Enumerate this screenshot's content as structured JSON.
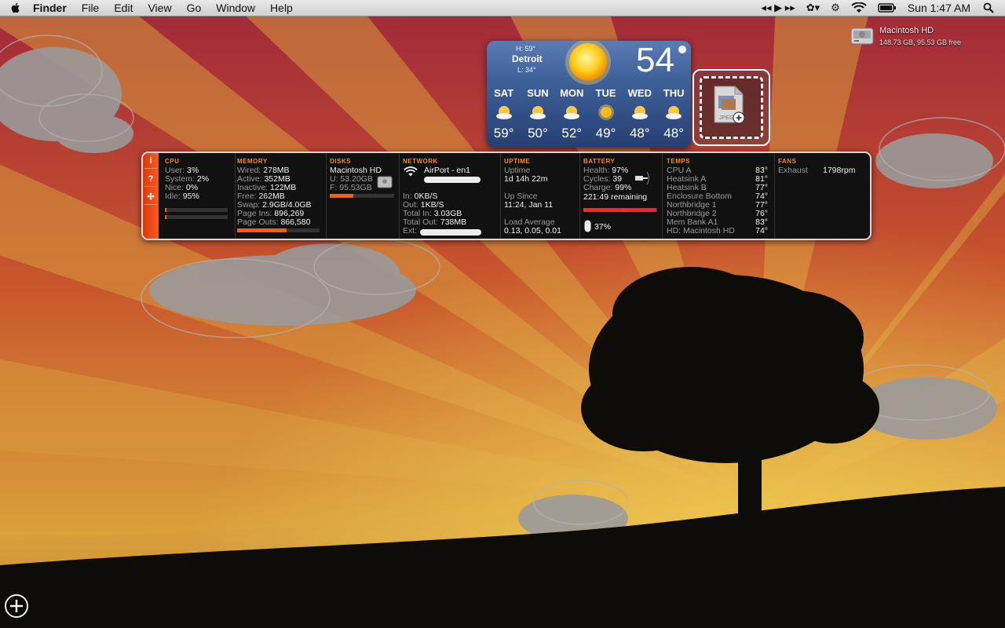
{
  "menubar": {
    "app": "Finder",
    "items": [
      "File",
      "Edit",
      "View",
      "Go",
      "Window",
      "Help"
    ],
    "clock": "Sun 1:47 AM",
    "icons": [
      "apple-icon",
      "media-controls-icon",
      "flower-icon",
      "gear-icon",
      "wifi-icon",
      "battery-icon",
      "spotlight-icon"
    ]
  },
  "desktop": {
    "disk_name": "Macintosh HD",
    "disk_info": "148.73 GB, 95.53 GB free"
  },
  "weather": {
    "city": "Detroit",
    "high": "H: 59°",
    "low": "L: 34°",
    "current_temp": "54",
    "days": [
      {
        "name": "SAT",
        "temp": "59°",
        "icon": "sun-cloud-icon"
      },
      {
        "name": "SUN",
        "temp": "50°",
        "icon": "sun-cloud-icon"
      },
      {
        "name": "MON",
        "temp": "52°",
        "icon": "sun-cloud-icon"
      },
      {
        "name": "TUE",
        "temp": "49°",
        "icon": "sun-icon"
      },
      {
        "name": "WED",
        "temp": "48°",
        "icon": "sun-cloud-icon"
      },
      {
        "name": "THU",
        "temp": "48°",
        "icon": "sun-cloud-icon"
      }
    ]
  },
  "istat": {
    "sidebar": [
      "i",
      "?",
      "✣"
    ],
    "cpu": {
      "title": "CPU",
      "rows": [
        [
          "User:",
          "3%"
        ],
        [
          "System:",
          "2%"
        ],
        [
          "Nice:",
          "0%"
        ],
        [
          "Idle:",
          "95%"
        ]
      ],
      "bar1_fraction": 0.03,
      "bar2_fraction": 0.02
    },
    "memory": {
      "title": "MEMORY",
      "rows": [
        [
          "Wired:",
          "278MB"
        ],
        [
          "Active:",
          "352MB"
        ],
        [
          "Inactive:",
          "122MB"
        ],
        [
          "Free:",
          "262MB"
        ],
        [
          "Swap:",
          "2.9GB/4.0GB"
        ],
        [
          "Page Ins:",
          "896,269"
        ],
        [
          "Page Outs:",
          "866,580"
        ]
      ],
      "bar_fraction": 0.6
    },
    "disks": {
      "title": "DISKS",
      "name": "Macintosh HD",
      "used": "U: 53.20GB",
      "free": "F: 95.53GB",
      "bar_fraction": 0.36
    },
    "network": {
      "title": "NETWORK",
      "iface": "AirPort - en1",
      "rows": [
        [
          "In:",
          "0KB/S"
        ],
        [
          "Out:",
          "1KB/S"
        ],
        [
          "Total In:",
          "3.03GB"
        ],
        [
          "Total Out:",
          "738MB"
        ],
        [
          "Ext:",
          ""
        ]
      ]
    },
    "uptime": {
      "title": "UPTIME",
      "uptime_label": "Uptime",
      "uptime": "1d 14h 22m",
      "since_label": "Up Since",
      "since": "11:24, Jan 11",
      "load_label": "Load Average",
      "load": "0.13, 0.05, 0.01"
    },
    "battery": {
      "title": "BATTERY",
      "rows": [
        [
          "Health:",
          "97%"
        ],
        [
          "Cycles:",
          "39"
        ],
        [
          "Charge:",
          "99%"
        ]
      ],
      "remaining": "221:49 remaining",
      "charge_fraction": 0.99,
      "mouse": "37%"
    },
    "temps": {
      "title": "TEMPS",
      "rows": [
        [
          "CPU A",
          "83°"
        ],
        [
          "Heatsink A",
          "81°"
        ],
        [
          "Heatsink B",
          "77°"
        ],
        [
          "Enclosure Bottom",
          "74°"
        ],
        [
          "Northbridge 1",
          "77°"
        ],
        [
          "Northbridge 2",
          "76°"
        ],
        [
          "Mem Bank A1",
          "83°"
        ],
        [
          "HD: Macintosh HD",
          "74°"
        ]
      ]
    },
    "fans": {
      "title": "FANS",
      "name": "Exhaust",
      "rpm": "1798rpm"
    }
  },
  "colors": {
    "accent": "#ff5a10",
    "header": "#f08a2a",
    "weather_bg": "#3d5f98"
  }
}
